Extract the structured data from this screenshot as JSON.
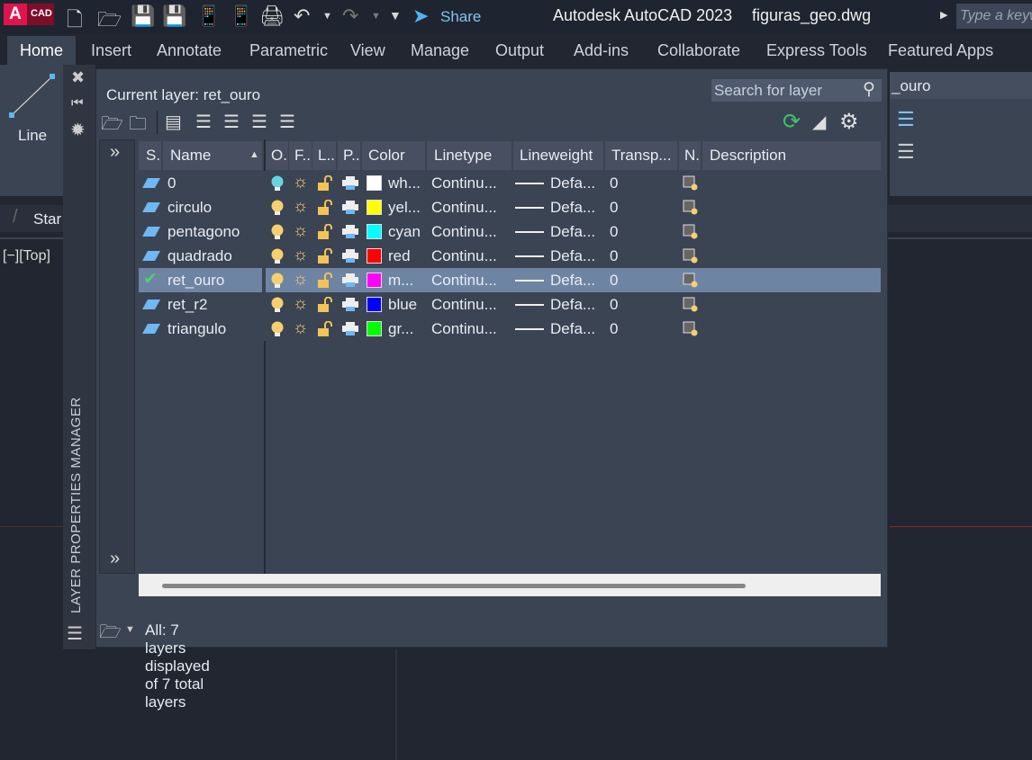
{
  "app": {
    "title": "Autodesk AutoCAD 2023",
    "file": "figuras_geo.dwg",
    "logo_a": "A",
    "logo_cad": "CAD",
    "share": "Share",
    "search_placeholder": "Type a keyword"
  },
  "ribbon_tabs": [
    "Home",
    "Insert",
    "Annotate",
    "Parametric",
    "View",
    "Manage",
    "Output",
    "Add-ins",
    "Collaborate",
    "Express Tools",
    "Featured Apps"
  ],
  "ribbon": {
    "line_label": "Line",
    "layer_combo": "_ouro"
  },
  "file_tab": "Star",
  "viewport_label": "[−][Top]",
  "palette": {
    "title": "LAYER PROPERTIES MANAGER",
    "current_layer": "Current layer: ret_ouro",
    "search_placeholder": "Search for layer",
    "columns": [
      "S..",
      "Name",
      "O..",
      "F..",
      "L..",
      "P..",
      "Color",
      "Linetype",
      "Lineweight",
      "Transp...",
      "N..",
      "Description"
    ],
    "layers": [
      {
        "name": "0",
        "color_name": "wh...",
        "color": "#ffffff",
        "linetype": "Continu...",
        "lineweight": "Defa...",
        "transparency": "0",
        "on_color": "#6ad3e0",
        "current": false
      },
      {
        "name": "circulo",
        "color_name": "yel...",
        "color": "#ffff00",
        "linetype": "Continu...",
        "lineweight": "Defa...",
        "transparency": "0",
        "on_color": "#f8cf6e",
        "current": false
      },
      {
        "name": "pentagono",
        "color_name": "cyan",
        "color": "#00ffff",
        "linetype": "Continu...",
        "lineweight": "Defa...",
        "transparency": "0",
        "on_color": "#f8cf6e",
        "current": false
      },
      {
        "name": "quadrado",
        "color_name": "red",
        "color": "#ff0000",
        "linetype": "Continu...",
        "lineweight": "Defa...",
        "transparency": "0",
        "on_color": "#f8cf6e",
        "current": false
      },
      {
        "name": "ret_ouro",
        "color_name": "m...",
        "color": "#ff00ff",
        "linetype": "Continu...",
        "lineweight": "Defa...",
        "transparency": "0",
        "on_color": "#f8cf6e",
        "current": true
      },
      {
        "name": "ret_r2",
        "color_name": "blue",
        "color": "#0000ff",
        "linetype": "Continu...",
        "lineweight": "Defa...",
        "transparency": "0",
        "on_color": "#f8cf6e",
        "current": false
      },
      {
        "name": "triangulo",
        "color_name": "gr...",
        "color": "#00ff00",
        "linetype": "Continu...",
        "lineweight": "Defa...",
        "transparency": "0",
        "on_color": "#f8cf6e",
        "current": false
      }
    ],
    "status": "All: 7 layers displayed of 7 total layers"
  }
}
